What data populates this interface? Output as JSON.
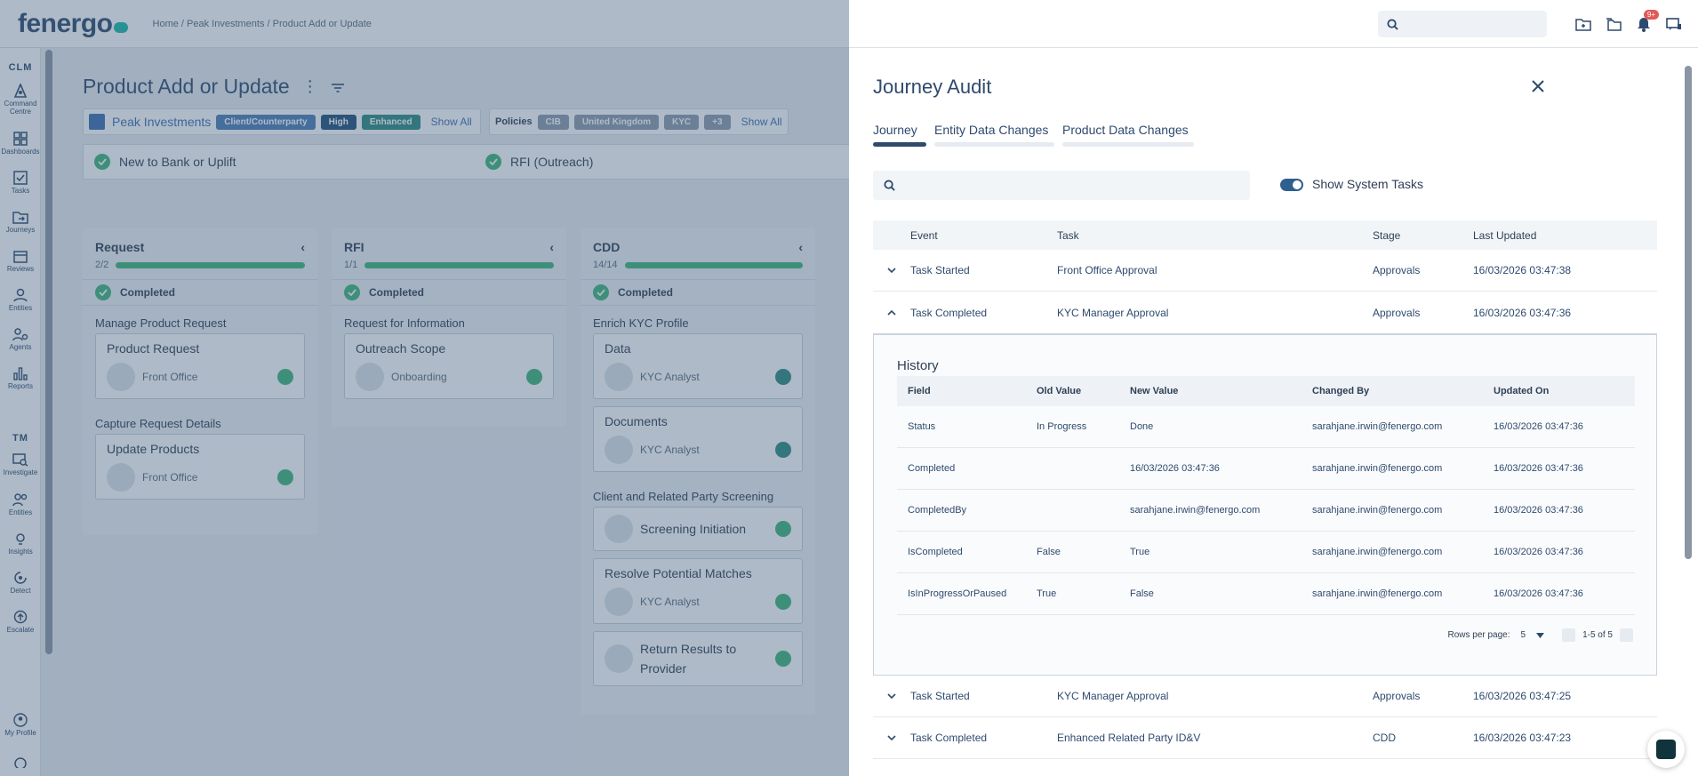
{
  "app": {
    "logo": "fenergo",
    "breadcrumb": "Home / Peak Investments / Product Add or Update",
    "notification_count": "9+"
  },
  "nav": {
    "clm_label": "CLM",
    "tm_label": "TM",
    "clm_items": [
      "Command Centre",
      "Dashboards",
      "Tasks",
      "Journeys",
      "Reviews",
      "Entities",
      "Agents",
      "Reports"
    ],
    "tm_items": [
      "Investigate",
      "Entities",
      "Insights",
      "Detect",
      "Escalate"
    ],
    "profile": "My Profile"
  },
  "page": {
    "title": "Product Add or Update",
    "entity_name": "Peak Investments",
    "entity_chips": [
      "Client/Counterparty",
      "High",
      "Enhanced"
    ],
    "show_all": "Show All",
    "policies_label": "Policies",
    "policy_chips": [
      "CIB",
      "United Kingdom",
      "KYC",
      "+3"
    ],
    "stages": [
      "New to Bank or Uplift",
      "RFI (Outreach)"
    ]
  },
  "board": {
    "completed_label": "Completed",
    "columns": [
      {
        "title": "Request",
        "count": "2/2",
        "groups": [
          {
            "label": "Manage Product Request",
            "tasks": [
              {
                "title": "Product Request",
                "assignee": "Front Office"
              }
            ]
          },
          {
            "label": "Capture Request Details",
            "tasks": [
              {
                "title": "Update Products",
                "assignee": "Front Office"
              }
            ]
          }
        ]
      },
      {
        "title": "RFI",
        "count": "1/1",
        "groups": [
          {
            "label": "Request for Information",
            "tasks": [
              {
                "title": "Outreach Scope",
                "assignee": "Onboarding"
              }
            ]
          }
        ]
      },
      {
        "title": "CDD",
        "count": "14/14",
        "groups": [
          {
            "label": "Enrich KYC Profile",
            "tasks": [
              {
                "title": "Data",
                "assignee": "KYC Analyst"
              },
              {
                "title": "Documents",
                "assignee": "KYC Analyst"
              }
            ]
          },
          {
            "label": "Client and Related Party Screening",
            "tasks": [
              {
                "title": "Screening Initiation",
                "assignee": ""
              },
              {
                "title": "Resolve Potential Matches",
                "assignee": "KYC Analyst"
              },
              {
                "title": "Return Results to Provider",
                "assignee": ""
              }
            ]
          }
        ]
      }
    ]
  },
  "drawer": {
    "title": "Journey Audit",
    "tabs": [
      "Journey",
      "Entity Data Changes",
      "Product Data Changes"
    ],
    "show_system_tasks": "Show System Tasks",
    "columns": {
      "event": "Event",
      "task": "Task",
      "stage": "Stage",
      "updated": "Last Updated"
    },
    "rows_before": [
      {
        "event": "Task Started",
        "task": "Front Office Approval",
        "stage": "Approvals",
        "updated": "16/03/2026 03:47:38"
      },
      {
        "event": "Task Completed",
        "task": "KYC Manager Approval",
        "stage": "Approvals",
        "updated": "16/03/2026 03:47:36"
      }
    ],
    "history": {
      "title": "History",
      "columns": {
        "field": "Field",
        "old": "Old Value",
        "new": "New Value",
        "by": "Changed By",
        "on": "Updated On"
      },
      "rows": [
        {
          "field": "Status",
          "old": "In Progress",
          "new": "Done",
          "by": "sarahjane.irwin@fenergo.com",
          "on": "16/03/2026 03:47:36"
        },
        {
          "field": "Completed",
          "old": "",
          "new": "16/03/2026 03:47:36",
          "by": "sarahjane.irwin@fenergo.com",
          "on": "16/03/2026 03:47:36"
        },
        {
          "field": "CompletedBy",
          "old": "",
          "new": "sarahjane.irwin@fenergo.com",
          "by": "sarahjane.irwin@fenergo.com",
          "on": "16/03/2026 03:47:36"
        },
        {
          "field": "IsCompleted",
          "old": "False",
          "new": "True",
          "by": "sarahjane.irwin@fenergo.com",
          "on": "16/03/2026 03:47:36"
        },
        {
          "field": "IsInProgressOrPaused",
          "old": "True",
          "new": "False",
          "by": "sarahjane.irwin@fenergo.com",
          "on": "16/03/2026 03:47:36"
        }
      ],
      "rows_per_page_label": "Rows per page:",
      "rows_per_page": "5",
      "range": "1-5 of 5"
    },
    "rows_after": [
      {
        "event": "Task Started",
        "task": "KYC Manager Approval",
        "stage": "Approvals",
        "updated": "16/03/2026 03:47:25"
      },
      {
        "event": "Task Completed",
        "task": "Enhanced Related Party ID&V",
        "stage": "CDD",
        "updated": "16/03/2026 03:47:23"
      }
    ]
  }
}
